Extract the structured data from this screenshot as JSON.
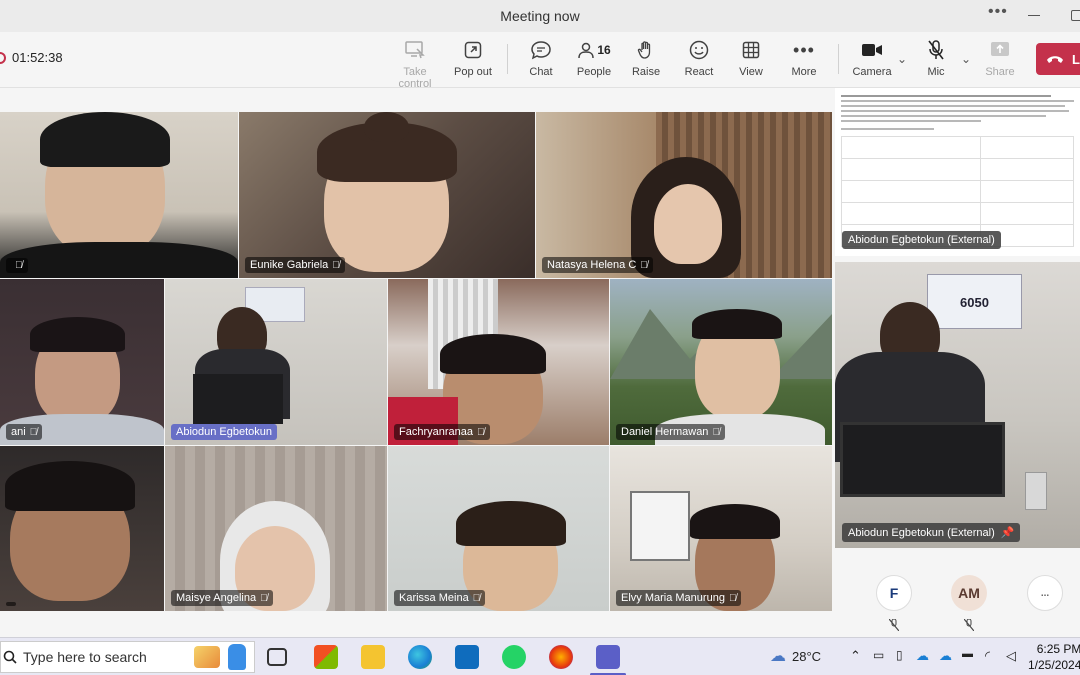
{
  "window": {
    "title": "Meeting now"
  },
  "toolbar": {
    "timer": "01:52:38",
    "take_control": "Take control",
    "pop_out": "Pop out",
    "chat": "Chat",
    "people": "People",
    "people_count": "16",
    "raise": "Raise",
    "react": "React",
    "view": "View",
    "more": "More",
    "camera": "Camera",
    "mic": "Mic",
    "share": "Share",
    "leave": "L"
  },
  "participants": {
    "p1": "",
    "p2": "Eunike Gabriela",
    "p3": "Natasya Helena C",
    "p4": "ani",
    "p5": "Abiodun Egbetokun",
    "p6": "Fachryanranaa",
    "p7": "Daniel Hermawan",
    "p8": "",
    "p9": "Maisye Angelina",
    "p10": "Karissa Meina",
    "p11": "Elvy Maria Manurung"
  },
  "shared_screen": {
    "presenter": "Abiodun Egbetokun (External)"
  },
  "pinned": {
    "name": "Abiodun Egbetokun (External)",
    "poster_number": "6050"
  },
  "roster": {
    "a1": "F",
    "a2": "AM",
    "more": "..."
  },
  "taskbar": {
    "search_placeholder": "Type here to search",
    "weather": "28°C",
    "time": "6:25 PM",
    "date": "1/25/2024"
  },
  "colors": {
    "leave": "#c4314b",
    "accent": "#5b5fc7",
    "taskbar": "#e8e8f4"
  }
}
